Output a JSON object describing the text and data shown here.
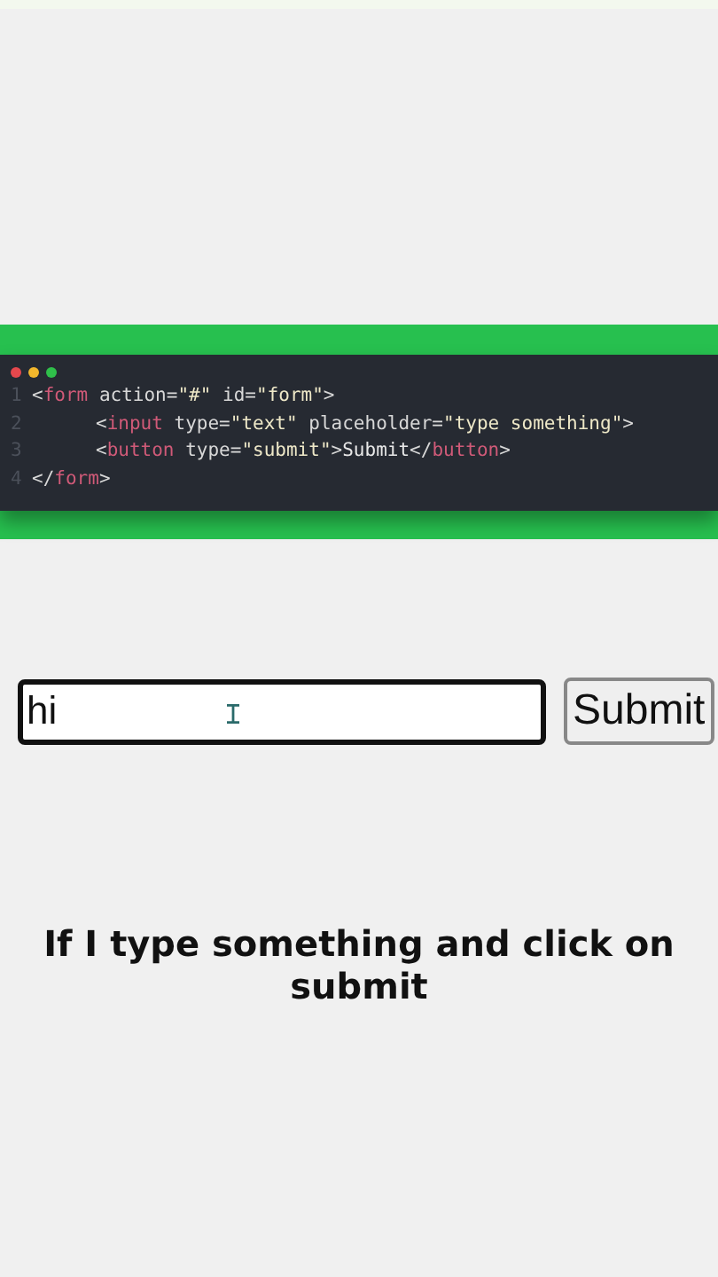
{
  "code_editor": {
    "lines": [
      {
        "number": "1",
        "tokens": [
          {
            "kind": "punct",
            "text": "<"
          },
          {
            "kind": "tag",
            "text": "form"
          },
          {
            "kind": "attr",
            "text": " action"
          },
          {
            "kind": "punct",
            "text": "="
          },
          {
            "kind": "string",
            "text": "\"#\""
          },
          {
            "kind": "attr",
            "text": " id"
          },
          {
            "kind": "punct",
            "text": "="
          },
          {
            "kind": "string",
            "text": "\"form\""
          },
          {
            "kind": "punct",
            "text": ">"
          }
        ],
        "children": [
          {
            "number": "2",
            "tokens": [
              {
                "kind": "punct",
                "text": "<"
              },
              {
                "kind": "tag",
                "text": "input"
              },
              {
                "kind": "attr",
                "text": " type"
              },
              {
                "kind": "punct",
                "text": "="
              },
              {
                "kind": "string",
                "text": "\"text\""
              },
              {
                "kind": "attr",
                "text": " placeholder"
              },
              {
                "kind": "punct",
                "text": "="
              },
              {
                "kind": "string",
                "text": "\"type something\""
              },
              {
                "kind": "punct",
                "text": ">"
              }
            ]
          },
          {
            "number": "3",
            "tokens": [
              {
                "kind": "punct",
                "text": "<"
              },
              {
                "kind": "tag",
                "text": "button"
              },
              {
                "kind": "attr",
                "text": " type"
              },
              {
                "kind": "punct",
                "text": "="
              },
              {
                "kind": "string",
                "text": "\"submit\""
              },
              {
                "kind": "punct",
                "text": ">"
              },
              {
                "kind": "text",
                "text": "Submit"
              },
              {
                "kind": "punct",
                "text": "</"
              },
              {
                "kind": "tag",
                "text": "button"
              },
              {
                "kind": "punct",
                "text": ">"
              }
            ]
          }
        ]
      },
      {
        "number": "4",
        "tokens": [
          {
            "kind": "punct",
            "text": "</"
          },
          {
            "kind": "tag",
            "text": "form"
          },
          {
            "kind": "punct",
            "text": ">"
          }
        ]
      }
    ]
  },
  "form": {
    "input": {
      "value": "hi"
    },
    "button": "Submit"
  },
  "caption": "If I type something and click on submit"
}
